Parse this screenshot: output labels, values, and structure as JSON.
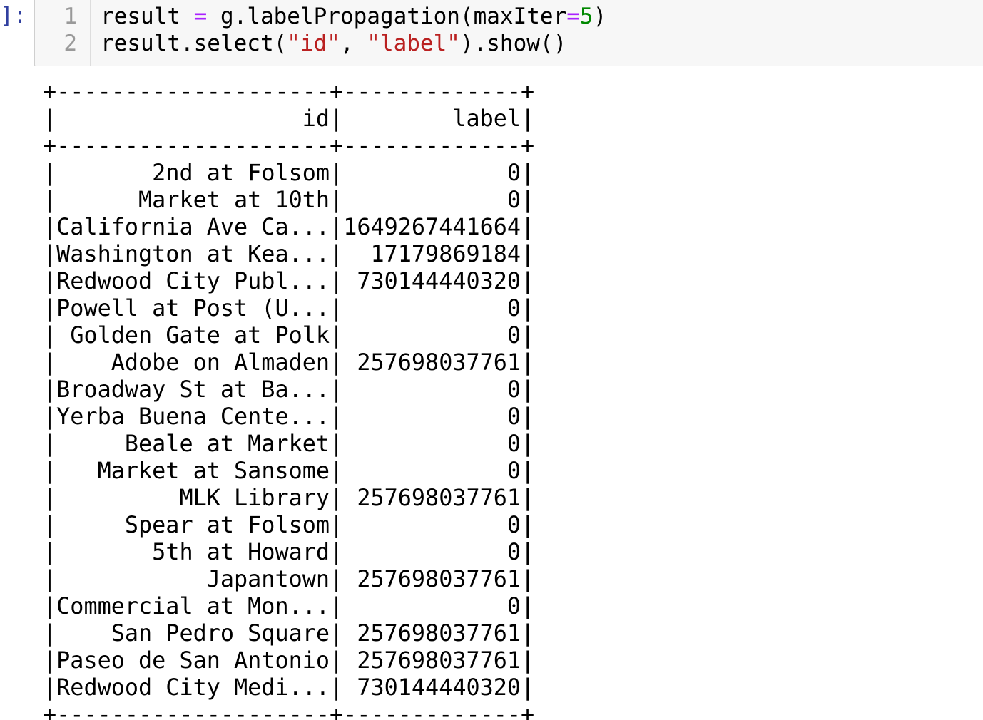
{
  "cell": {
    "prompt": "]:",
    "line_numbers": [
      "1",
      "2"
    ],
    "code_lines": [
      [
        {
          "t": "result ",
          "c": ""
        },
        {
          "t": "=",
          "c": "op"
        },
        {
          "t": " g.labelPropagation(maxIter",
          "c": ""
        },
        {
          "t": "=",
          "c": "op"
        },
        {
          "t": "5",
          "c": "num"
        },
        {
          "t": ")",
          "c": ""
        }
      ],
      [
        {
          "t": "result.select(",
          "c": ""
        },
        {
          "t": "\"id\"",
          "c": "str"
        },
        {
          "t": ", ",
          "c": ""
        },
        {
          "t": "\"label\"",
          "c": "str"
        },
        {
          "t": ").show()",
          "c": ""
        }
      ]
    ]
  },
  "output_table": {
    "columns": [
      "id",
      "label"
    ],
    "col_widths": [
      20,
      13
    ],
    "rows": [
      [
        "2nd at Folsom",
        "0"
      ],
      [
        "Market at 10th",
        "0"
      ],
      [
        "California Ave Ca...",
        "1649267441664"
      ],
      [
        "Washington at Kea...",
        "17179869184"
      ],
      [
        "Redwood City Publ...",
        "730144440320"
      ],
      [
        "Powell at Post (U...",
        "0"
      ],
      [
        "Golden Gate at Polk",
        "0"
      ],
      [
        "Adobe on Almaden",
        "257698037761"
      ],
      [
        "Broadway St at Ba...",
        "0"
      ],
      [
        "Yerba Buena Cente...",
        "0"
      ],
      [
        "Beale at Market",
        "0"
      ],
      [
        "Market at Sansome",
        "0"
      ],
      [
        "MLK Library",
        "257698037761"
      ],
      [
        "Spear at Folsom",
        "0"
      ],
      [
        "5th at Howard",
        "0"
      ],
      [
        "Japantown",
        "257698037761"
      ],
      [
        "Commercial at Mon...",
        "0"
      ],
      [
        "San Pedro Square",
        "257698037761"
      ],
      [
        "Paseo de San Antonio",
        "257698037761"
      ],
      [
        "Redwood City Medi...",
        "730144440320"
      ]
    ]
  }
}
